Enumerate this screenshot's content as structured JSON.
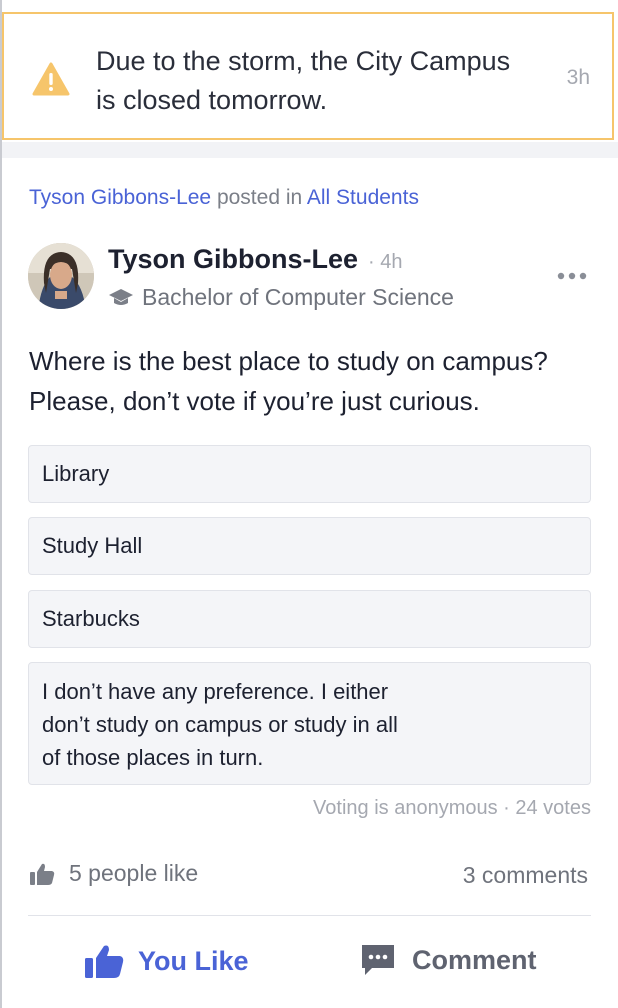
{
  "alert": {
    "line1": "Due to the storm, the City Campus",
    "line2": "is closed tomorrow.",
    "time": "3h",
    "icon": "warning-icon",
    "color": "#f6c56b"
  },
  "post": {
    "posted_by": "Tyson Gibbons-Lee",
    "posted_in_text": "posted in",
    "group": "All Students",
    "author": {
      "name": "Tyson Gibbons-Lee",
      "time_sep": "·",
      "time": "4h",
      "degree": "Bachelor of Computer Science"
    },
    "question_line1": "Where is the best place to study on campus?",
    "question_line2": "Please, don’t vote if you’re just curious.",
    "poll": {
      "options": [
        "Library",
        "Study Hall",
        "Starbucks",
        {
          "line1": "I don’t have any preference. I either",
          "line2": "don’t study on campus or study in all",
          "line3": "of those places in turn."
        }
      ],
      "meta": "Voting is anonymous · 24 votes"
    },
    "likes_text": "5 people like",
    "comments_text": "3 comments",
    "actions": {
      "like_label": "You Like",
      "comment_label": "Comment"
    }
  },
  "colors": {
    "accent": "#4a63d6",
    "warning": "#f6c56b",
    "muted": "#a5a8b0"
  }
}
